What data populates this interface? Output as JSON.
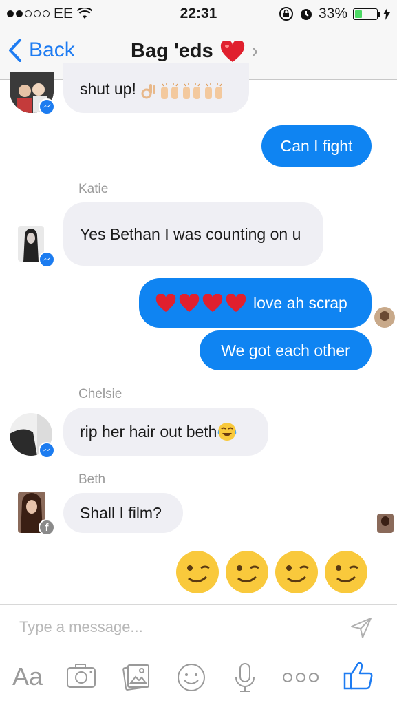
{
  "status_bar": {
    "carrier": "EE",
    "time": "22:31",
    "battery_percent": "33%",
    "battery_level": 0.33,
    "icons": [
      "signal-dots-icon",
      "wifi-icon",
      "rotation-lock-icon",
      "alarm-icon",
      "battery-icon",
      "charging-icon"
    ]
  },
  "nav": {
    "back_label": "Back",
    "title": "Bag 'eds"
  },
  "messages": {
    "m1_text": "shut up!",
    "m2_text": "Can I fight",
    "katie_name": "Katie",
    "m3_text": "Yes Bethan I was counting on u",
    "m4_text": "love ah scrap",
    "m5_text": "We got each other",
    "chelsie_name": "Chelsie",
    "m6_text": "rip her hair out beth",
    "beth_name": "Beth",
    "m7_text": "Shall I film?"
  },
  "composer": {
    "placeholder": "Type a message..."
  },
  "toolbar": {
    "aa_label": "Aa",
    "items": [
      "camera-icon",
      "photo-icon",
      "sticker-icon",
      "microphone-icon",
      "more-icon",
      "like-icon"
    ]
  },
  "colors": {
    "accent": "#1e7cf2",
    "sent_bubble": "#0f84f2",
    "received_bubble": "#efeff4",
    "heart": "#e0202e"
  }
}
